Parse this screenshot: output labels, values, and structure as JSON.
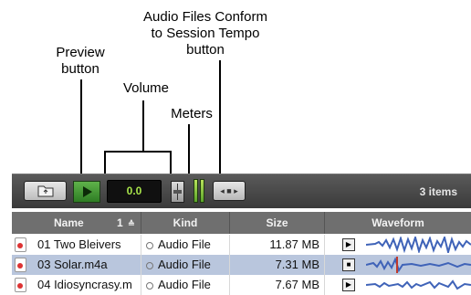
{
  "callouts": {
    "conform": "Audio Files Conform\nto Session Tempo\nbutton",
    "preview": "Preview\nbutton",
    "volume": "Volume",
    "meters": "Meters"
  },
  "toolbar": {
    "volume_value": "0.0",
    "items_count": "3 items",
    "conform_glyph": "◂ ■ ▸"
  },
  "table": {
    "headers": {
      "name": "Name",
      "sort": "1",
      "kind": "Kind",
      "size": "Size",
      "waveform": "Waveform"
    },
    "rows": [
      {
        "name": "01 Two Bleivers",
        "kind": "Audio File",
        "size": "11.87 MB"
      },
      {
        "name": "03 Solar.m4a",
        "kind": "Audio File",
        "size": "7.31 MB"
      },
      {
        "name": "04 Idiosyncrasy.m",
        "kind": "Audio File",
        "size": "7.67 MB"
      }
    ]
  },
  "colors": {
    "waveform": "#3f63b8",
    "meter_green": "#8fd14a",
    "volume_text": "#a7e34a",
    "selected_row": "#b9c6dd"
  }
}
